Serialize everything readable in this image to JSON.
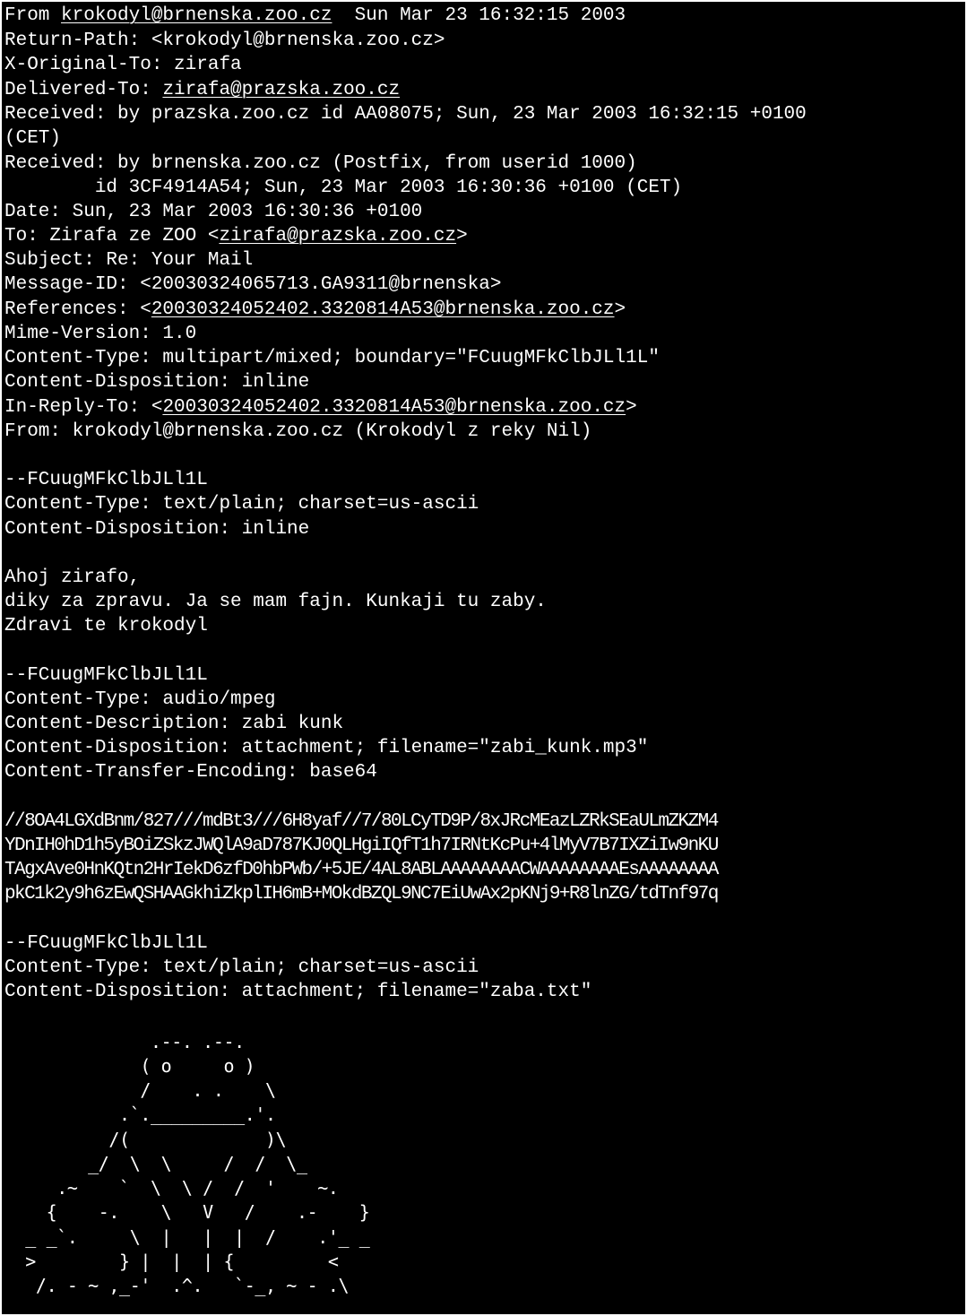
{
  "colors": {
    "background": "#000000",
    "text": "#ffffff"
  },
  "headers": {
    "from_line": {
      "prefix": "From ",
      "address": "krokodyl@brnenska.zoo.cz",
      "date": "  Sun Mar 23 16:32:15 2003"
    },
    "return_path": "Return-Path: <krokodyl@brnenska.zoo.cz>",
    "x_original_to": "X-Original-To: zirafa",
    "delivered_to": {
      "label": "Delivered-To: ",
      "address": "zirafa@prazska.zoo.cz"
    },
    "received_1": "Received: by prazska.zoo.cz id AA08075; Sun, 23 Mar 2003 16:32:15 +0100",
    "received_1_cont": "(CET)",
    "received_2": "Received: by brnenska.zoo.cz (Postfix, from userid 1000)",
    "received_2_cont": "        id 3CF4914A54; Sun, 23 Mar 2003 16:30:36 +0100 (CET)",
    "date": "Date: Sun, 23 Mar 2003 16:30:36 +0100",
    "to": {
      "label": "To: Zirafa ze ZOO <",
      "address": "zirafa@prazska.zoo.cz",
      "suffix": ">"
    },
    "subject": "Subject: Re: Your Mail",
    "message_id": "Message-ID: <20030324065713.GA9311@brnenska>",
    "references": {
      "label": "References: <",
      "address": "20030324052402.3320814A53@brnenska.zoo.cz",
      "suffix": ">"
    },
    "mime_version": "Mime-Version: 1.0",
    "content_type": "Content-Type: multipart/mixed; boundary=\"FCuugMFkClbJLl1L\"",
    "content_disposition": "Content-Disposition: inline",
    "in_reply_to": {
      "label": "In-Reply-To: <",
      "address": "20030324052402.3320814A53@brnenska.zoo.cz",
      "suffix": ">"
    },
    "from_full": "From: krokodyl@brnenska.zoo.cz (Krokodyl z reky Nil)"
  },
  "part1": {
    "boundary": "--FCuugMFkClbJLl1L",
    "content_type": "Content-Type: text/plain; charset=us-ascii",
    "content_disposition": "Content-Disposition: inline",
    "body": [
      "Ahoj zirafo,",
      "diky za zpravu. Ja se mam fajn. Kunkaji tu zaby.",
      "Zdravi te krokodyl"
    ]
  },
  "part2": {
    "boundary": "--FCuugMFkClbJLl1L",
    "content_type": "Content-Type: audio/mpeg",
    "content_description": "Content-Description: zabi kunk",
    "content_disposition": "Content-Disposition: attachment; filename=\"zabi_kunk.mp3\"",
    "content_transfer_encoding": "Content-Transfer-Encoding: base64",
    "base64": [
      "//8OA4LGXdBnm/827///mdBt3///6H8yaf//7/80LCyTD9P/8xJRcMEazLZRkSEaULmZKZM4",
      "YDnIH0hD1h5yBOiZSkzJWQlA9aD787KJ0QLHgiIQfT1h7IRNtKcPu+4lMyV7B7IXZiIw9nKU",
      "TAgxAve0HnKQtn2HrIekD6zfD0hbPWb/+5JE/4AL8ABLAAAAAAAACWAAAAAAAAEsAAAAAAAA",
      "pkC1k2y9h6zEwQSHAAGkhiZkplIH6mB+MOkdBZQL9NC7EiUwAx2pKNj9+R8lnZG/tdTnf97q"
    ]
  },
  "part3": {
    "boundary": "--FCuugMFkClbJLl1L",
    "content_type": "Content-Type: text/plain; charset=us-ascii",
    "content_disposition": "Content-Disposition: attachment; filename=\"zaba.txt\"",
    "ascii_art": [
      "              .--. .--.",
      "             ( o     o )",
      "             /    . .    \\",
      "           .`._________.'.",
      "          /(             )\\",
      "        _/  \\  \\     /  /  \\_",
      "     .~    `  \\  \\ /  /  '    ~.",
      "    {    -.    \\   V   /    .-    }",
      "  _ _`.     \\  |   |  |  /    .'_ _",
      "  >        } |  |  | {         <",
      "   /. - ~ ,_-'  .^.   `-_, ~ - .\\"
    ]
  }
}
